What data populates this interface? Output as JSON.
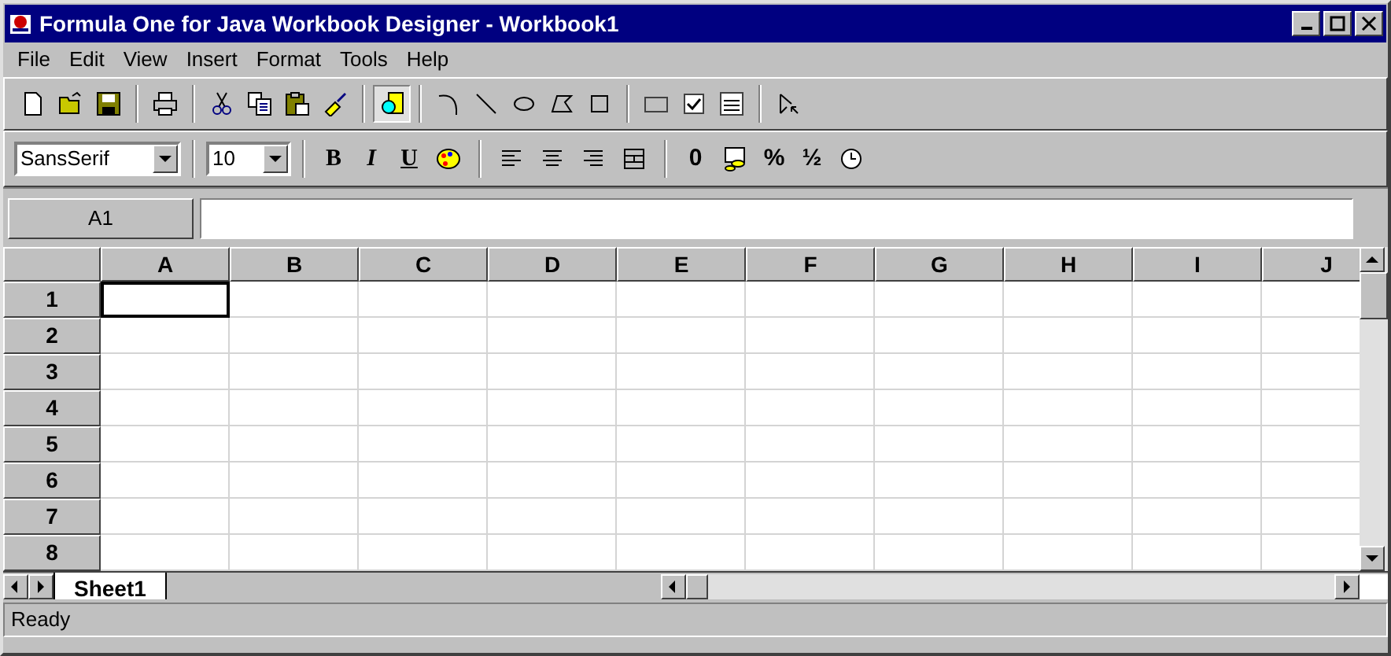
{
  "window": {
    "title": "Formula One for Java Workbook Designer - Workbook1"
  },
  "menu": [
    "File",
    "Edit",
    "View",
    "Insert",
    "Format",
    "Tools",
    "Help"
  ],
  "toolbar": [
    {
      "kind": "new"
    },
    {
      "kind": "open"
    },
    {
      "kind": "save"
    },
    {
      "kind": "sep"
    },
    {
      "kind": "print"
    },
    {
      "kind": "sep"
    },
    {
      "kind": "cut"
    },
    {
      "kind": "copy"
    },
    {
      "kind": "paste"
    },
    {
      "kind": "brush"
    },
    {
      "kind": "sep"
    },
    {
      "kind": "drawmode",
      "selected": true
    },
    {
      "kind": "sep"
    },
    {
      "kind": "arc"
    },
    {
      "kind": "line"
    },
    {
      "kind": "ellipse"
    },
    {
      "kind": "polygon"
    },
    {
      "kind": "rect"
    },
    {
      "kind": "sep"
    },
    {
      "kind": "button"
    },
    {
      "kind": "checkbox"
    },
    {
      "kind": "listbox"
    },
    {
      "kind": "sep"
    },
    {
      "kind": "select"
    }
  ],
  "format_bar": {
    "font": "SansSerif",
    "size": "10",
    "items": [
      {
        "kind": "bold",
        "label": "B"
      },
      {
        "kind": "italic",
        "label": "I"
      },
      {
        "kind": "underline",
        "label": "U"
      },
      {
        "kind": "palette"
      },
      {
        "kind": "sep"
      },
      {
        "kind": "left"
      },
      {
        "kind": "center"
      },
      {
        "kind": "right"
      },
      {
        "kind": "merge"
      },
      {
        "kind": "sep"
      },
      {
        "kind": "text",
        "label": "0"
      },
      {
        "kind": "currency"
      },
      {
        "kind": "text",
        "label": "%"
      },
      {
        "kind": "text",
        "label": "½"
      },
      {
        "kind": "clock"
      }
    ]
  },
  "formula_bar": {
    "cell": "A1"
  },
  "sheet": {
    "columns": [
      "A",
      "B",
      "C",
      "D",
      "E",
      "F",
      "G",
      "H",
      "I",
      "J"
    ],
    "rows": [
      "1",
      "2",
      "3",
      "4",
      "5",
      "6",
      "7",
      "8"
    ]
  },
  "tabs": [
    {
      "label": "Sheet1",
      "selected": true
    }
  ],
  "status_bar": "Ready"
}
